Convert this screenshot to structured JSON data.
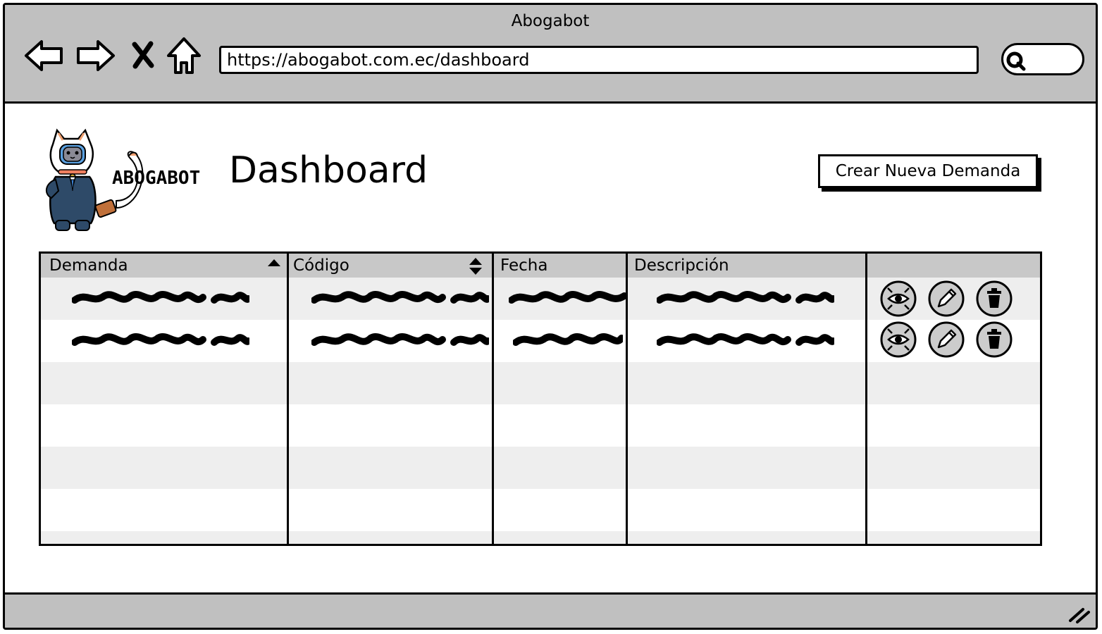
{
  "window": {
    "title": "Abogabot"
  },
  "browser": {
    "url": "https://abogabot.com.ec/dashboard",
    "nav_icons": [
      "back-arrow-icon",
      "forward-arrow-icon",
      "close-x-icon",
      "home-icon"
    ],
    "search_icon": "magnifier-icon"
  },
  "header": {
    "logo_text": "ABOGABOT",
    "page_title": "Dashboard",
    "create_button": "Crear Nueva Demanda"
  },
  "table": {
    "columns": [
      {
        "label": "Demanda",
        "sort": "ascending"
      },
      {
        "label": "Código",
        "sort": "sortable"
      },
      {
        "label": "Fecha",
        "sort": "none"
      },
      {
        "label": "Descripción",
        "sort": "none"
      },
      {
        "label": "",
        "sort": "none"
      }
    ],
    "rows": [
      {
        "content": "scribbled-placeholder",
        "actions": [
          "view-icon",
          "edit-pencil-icon",
          "delete-trash-icon"
        ]
      },
      {
        "content": "scribbled-placeholder",
        "actions": [
          "view-icon",
          "edit-pencil-icon",
          "delete-trash-icon"
        ]
      }
    ],
    "empty_rows": 4
  },
  "colors": {
    "chrome": "#c0c0c0",
    "header_row": "#c8c8c8",
    "alt_row": "#eeeeee"
  }
}
